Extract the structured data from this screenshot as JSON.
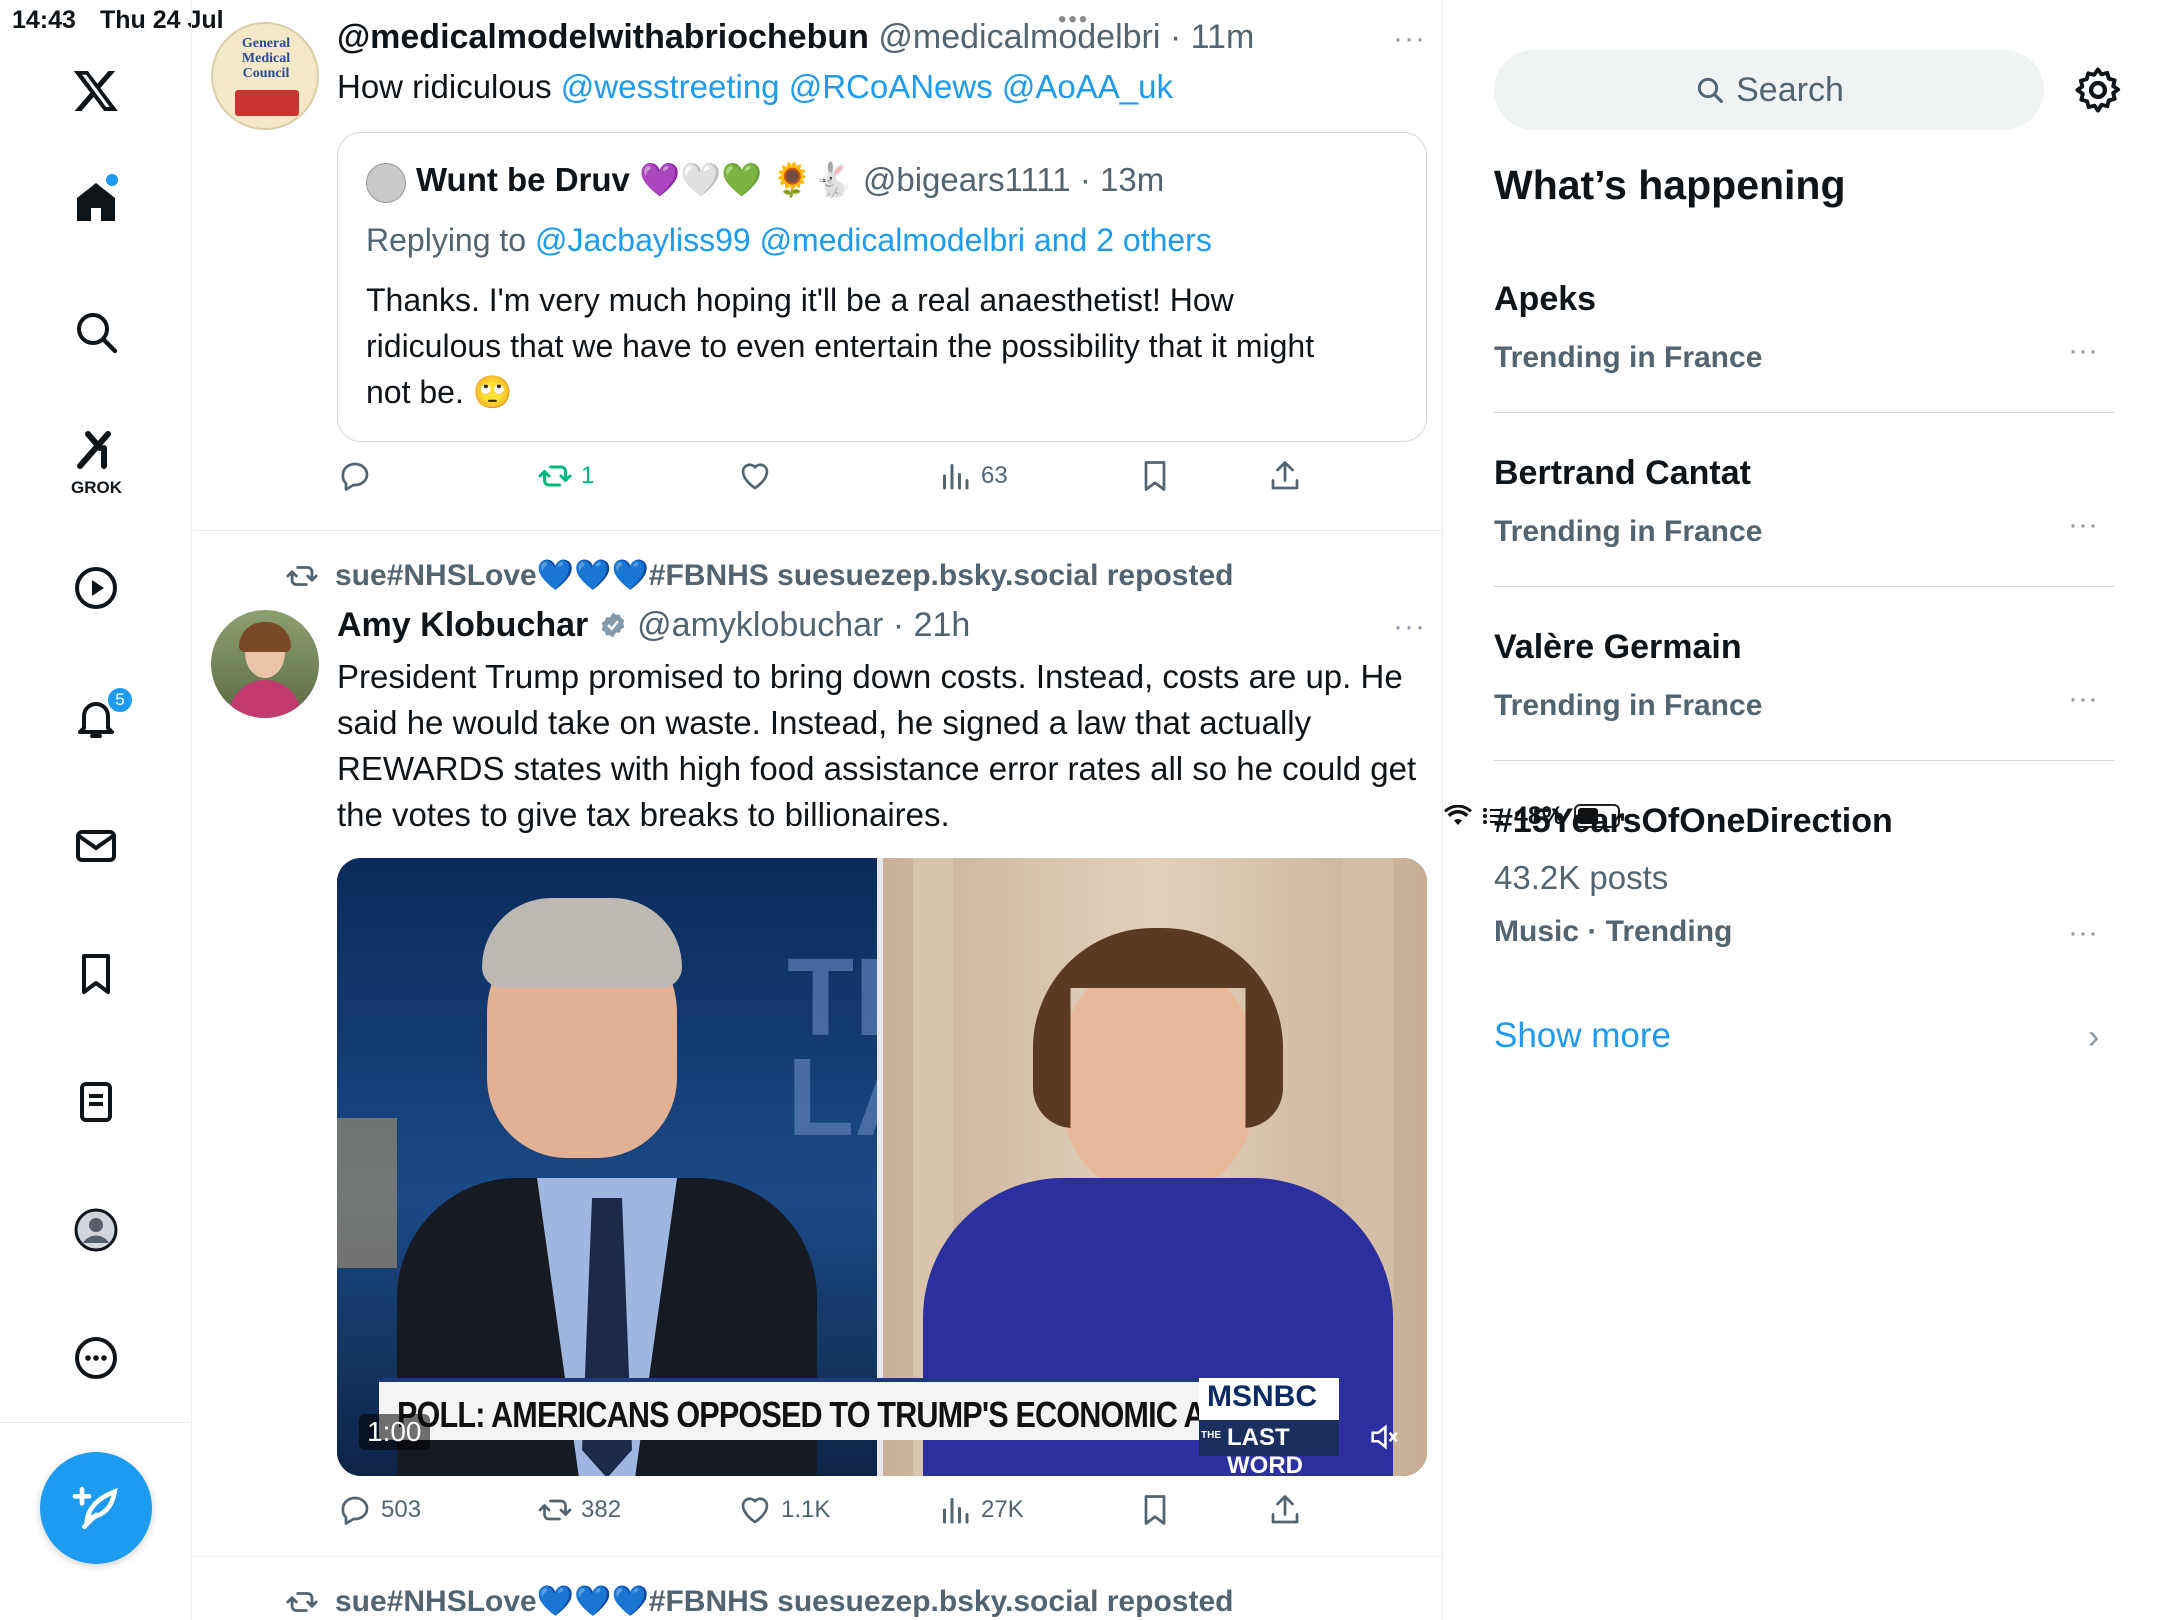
{
  "status_bar": {
    "time": "14:43",
    "date": "Thu 24 Jul",
    "battery": "48%",
    "battery_level": 0.48
  },
  "nav": {
    "grok_label": "GROK",
    "notifications_count": "5",
    "items": [
      "x-logo-icon",
      "home-icon",
      "search-icon",
      "grok-icon",
      "video-icon",
      "bell-icon",
      "mail-icon",
      "bookmark-icon",
      "list-icon",
      "profile-icon",
      "more-icon"
    ]
  },
  "feed": {
    "tweet1": {
      "display_name": "@medicalmodelwithabriochebun",
      "handle": "@medicalmodelbri",
      "time": "11m",
      "text_prefix": "How ridiculous",
      "mentions": "@wesstreeting @RCoANews @AoAA_uk",
      "avatar_text": "General Medical Council",
      "quote": {
        "display_name": "Wunt be Druv",
        "emoji": "💜🤍💚 🌻🐇",
        "handle": "@bigears1111",
        "time": "13m",
        "replying_prefix": "Replying to",
        "replying_to": "@Jacbayliss99 @medicalmodelbri and 2 others",
        "text": "Thanks. I'm very much hoping it'll be a real anaesthetist! How ridiculous that we have to even entertain the possibility that it might not be.  🙄"
      },
      "actions": {
        "replies": "",
        "reposts": "1",
        "likes": "",
        "views": "63"
      }
    },
    "tweet2": {
      "repost_by": "sue#NHSLove💙💙💙#FBNHS suesuezep.bsky.social reposted",
      "display_name": "Amy Klobuchar",
      "handle": "@amyklobuchar",
      "time": "21h",
      "text": "President Trump promised to bring down costs. Instead, costs are up. He said he would take on waste. Instead, he signed a law that actually REWARDS states with high food assistance error rates all so he could get the votes to give tax breaks to billionaires.",
      "video": {
        "chyron": "POLL: AMERICANS OPPOSED TO TRUMP'S ECONOMIC AGENDA",
        "network": "MSNBC",
        "show": "LAST WORD",
        "show_prefix": "THE",
        "backdrop_text": "THE LA",
        "duration": "1:00"
      },
      "actions": {
        "replies": "503",
        "reposts": "382",
        "likes": "1.1K",
        "views": "27K"
      }
    },
    "tweet3": {
      "repost_by": "sue#NHSLove💙💙💙#FBNHS suesuezep.bsky.social reposted"
    }
  },
  "sidebar": {
    "search_placeholder": "Search",
    "title": "What’s happening",
    "trends": [
      {
        "name": "Apeks",
        "context": "Trending in France"
      },
      {
        "name": "Bertrand Cantat",
        "context": "Trending in France"
      },
      {
        "name": "Valère Germain",
        "context": "Trending in France"
      },
      {
        "name": "#15YearsOfOneDirection",
        "posts": "43.2K posts",
        "context": "Music · Trending"
      }
    ],
    "show_more": "Show more"
  },
  "colors": {
    "accent": "#1d9bf0",
    "retweet_green": "#00ba7c",
    "muted": "#536471"
  }
}
